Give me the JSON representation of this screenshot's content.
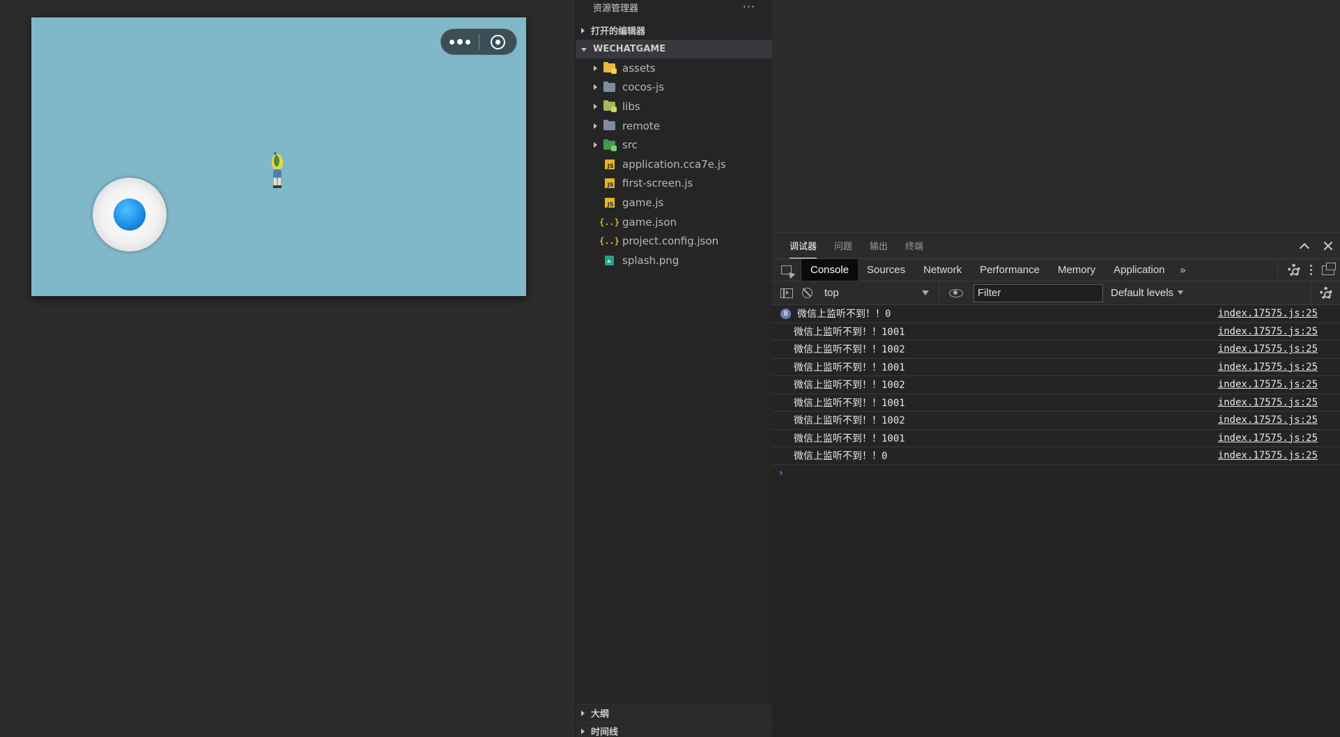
{
  "explorer": {
    "title": "资源管理器",
    "more_label": "···",
    "open_editors_label": "打开的编辑器",
    "project_label": "WECHATGAME",
    "items": [
      {
        "name": "assets",
        "type": "folder",
        "color": "#e8b93b",
        "badge": "#f0d050"
      },
      {
        "name": "cocos-js",
        "type": "folder",
        "color": "#7e8c9c",
        "badge": ""
      },
      {
        "name": "libs",
        "type": "folder",
        "color": "#a3b85a",
        "badge": "#c9d96b"
      },
      {
        "name": "remote",
        "type": "folder",
        "color": "#7e8c9c",
        "badge": ""
      },
      {
        "name": "src",
        "type": "folder",
        "color": "#3f9b4c",
        "badge": "#7ad06f"
      },
      {
        "name": "application.cca7e.js",
        "type": "js"
      },
      {
        "name": "first-screen.js",
        "type": "js"
      },
      {
        "name": "game.js",
        "type": "js"
      },
      {
        "name": "game.json",
        "type": "json"
      },
      {
        "name": "project.config.json",
        "type": "json"
      },
      {
        "name": "splash.png",
        "type": "png"
      }
    ],
    "outline_label": "大纲",
    "timeline_label": "时间线"
  },
  "panel_tabs": {
    "debugger": "调试器",
    "problems": "问题",
    "output": "输出",
    "terminal": "终端"
  },
  "devtools_tabs": {
    "console": "Console",
    "sources": "Sources",
    "network": "Network",
    "performance": "Performance",
    "memory": "Memory",
    "application": "Application",
    "more": "»"
  },
  "console_toolbar": {
    "context": "top",
    "filter_placeholder": "Filter",
    "levels": "Default levels"
  },
  "console_log": [
    {
      "count": "8",
      "message": "微信上监听不到！！0",
      "source": "index.17575.js:25"
    },
    {
      "message": "微信上监听不到！！1001",
      "source": "index.17575.js:25"
    },
    {
      "message": "微信上监听不到！！1002",
      "source": "index.17575.js:25"
    },
    {
      "message": "微信上监听不到！！1001",
      "source": "index.17575.js:25"
    },
    {
      "message": "微信上监听不到！！1002",
      "source": "index.17575.js:25"
    },
    {
      "message": "微信上监听不到！！1001",
      "source": "index.17575.js:25"
    },
    {
      "message": "微信上监听不到！！1002",
      "source": "index.17575.js:25"
    },
    {
      "message": "微信上监听不到！！1001",
      "source": "index.17575.js:25"
    },
    {
      "message": "微信上监听不到！！0",
      "source": "index.17575.js:25"
    }
  ],
  "prompt": "›"
}
